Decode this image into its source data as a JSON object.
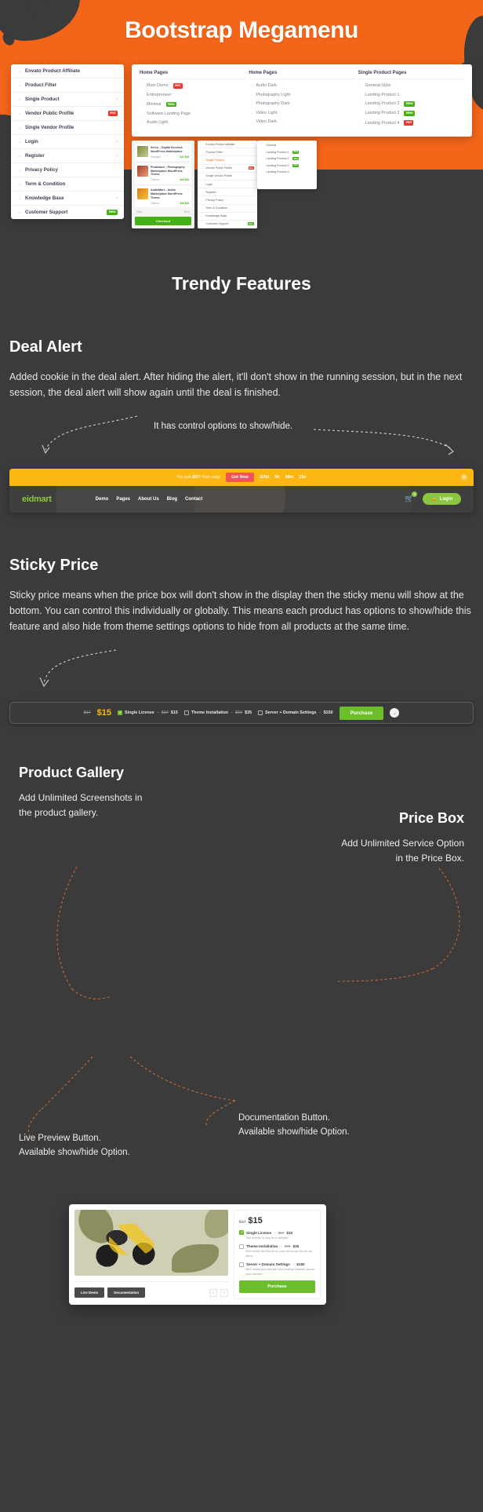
{
  "hero": {
    "title": "Bootstrap Megamenu",
    "bg": "#f3661a"
  },
  "megamenu": {
    "left_items": [
      {
        "label": "Envato Product Affiliate",
        "badge": "",
        "chevron": false
      },
      {
        "label": "Product Filter",
        "badge": "",
        "chevron": false
      },
      {
        "label": "Single Product",
        "badge": "",
        "chevron": true
      },
      {
        "label": "Vendor Public Profile",
        "badge": "Hot",
        "badge_type": "hot",
        "chevron": false
      },
      {
        "label": "Single Vendor Profile",
        "badge": "",
        "chevron": false
      },
      {
        "label": "Login",
        "badge": "",
        "chevron": true
      },
      {
        "label": "Register",
        "badge": "",
        "chevron": true
      },
      {
        "label": "Privacy Policy",
        "badge": "",
        "chevron": false
      },
      {
        "label": "Term & Condition",
        "badge": "",
        "chevron": false
      },
      {
        "label": "Knowledge Base",
        "badge": "",
        "chevron": true
      },
      {
        "label": "Customer Support",
        "badge": "New",
        "badge_type": "new",
        "chevron": false
      }
    ],
    "columns": [
      {
        "heading": "Home Pages",
        "items": [
          {
            "label": "Main Demo",
            "badge": "Hot",
            "badge_type": "hot"
          },
          {
            "label": "Entrepreneur",
            "badge": ""
          },
          {
            "label": "Minimal",
            "badge": "New",
            "badge_type": "new"
          },
          {
            "label": "Software Landing Page",
            "badge": ""
          },
          {
            "label": "Audio Light",
            "badge": ""
          }
        ]
      },
      {
        "heading": "Home Pages",
        "items": [
          {
            "label": "Audio Dark",
            "badge": ""
          },
          {
            "label": "Photography Light",
            "badge": ""
          },
          {
            "label": "Photography Dark",
            "badge": ""
          },
          {
            "label": "Video Light",
            "badge": ""
          },
          {
            "label": "Video Dark",
            "badge": ""
          }
        ]
      },
      {
        "heading": "Single Product Pages",
        "items": [
          {
            "label": "General Style",
            "badge": ""
          },
          {
            "label": "Landing Product 1",
            "badge": ""
          },
          {
            "label": "Landing Product 2",
            "badge": "New",
            "badge_type": "new"
          },
          {
            "label": "Landing Product 3",
            "badge": "New",
            "badge_type": "new"
          },
          {
            "label": "Landing Product 4",
            "badge": "Hot",
            "badge_type": "hot"
          }
        ]
      }
    ],
    "product_card": {
      "products": [
        {
          "name": "Servo – Digital Services WordPress Marketplace",
          "category": "Template",
          "price": "$47 $35"
        },
        {
          "name": "Photoland – Photography Marketplace WordPress Theme",
          "category": "Themes",
          "price": "$49 $39"
        },
        {
          "name": "AudioMart – Audio Marketplace WordPress Theme",
          "category": "Themes",
          "price": "$45 $29"
        }
      ],
      "total_label": "Total",
      "total_value": "$103",
      "button": "Checkout"
    },
    "mini_menu": [
      {
        "label": "Envato Product Affiliate",
        "badge": ""
      },
      {
        "label": "Product Filter",
        "badge": ""
      },
      {
        "label": "Single Product",
        "badge": "",
        "active": true
      },
      {
        "label": "Vendor Public Profile",
        "badge": "Hot",
        "badge_type": "hot"
      },
      {
        "label": "Single Vendor Profile",
        "badge": ""
      },
      {
        "label": "Login",
        "badge": "",
        "chevron": true
      },
      {
        "label": "Register",
        "badge": "",
        "chevron": true
      },
      {
        "label": "Privacy Policy",
        "badge": ""
      },
      {
        "label": "Term & Condition",
        "badge": ""
      },
      {
        "label": "Knowledge Base",
        "badge": ""
      },
      {
        "label": "Customer Support",
        "badge": "New",
        "badge_type": "new"
      }
    ],
    "mini_menu2": [
      {
        "label": "General",
        "badge": ""
      },
      {
        "label": "Landing Product 1",
        "badge": "New",
        "badge_type": "new"
      },
      {
        "label": "Landing Product 2",
        "badge": "New",
        "badge_type": "new"
      },
      {
        "label": "Landing Product 3",
        "badge": "New",
        "badge_type": "new"
      },
      {
        "label": "Landing Product 4",
        "badge": ""
      }
    ]
  },
  "features_title": "Trendy Features",
  "deal_alert": {
    "heading": "Deal Alert",
    "body": "Added cookie in the deal alert. After hiding the alert, it'll don't show in the running session, but in the next session, the deal alert will show again until the deal is finished.",
    "annotation": "It has control options to show/hide.",
    "bar": {
      "text_prefix": "For just ",
      "price": "$57!",
      "text_suffix": " Your copy",
      "button": "Get Now",
      "countdown": [
        "326d",
        "5h",
        "58m",
        "15s"
      ],
      "close_icon": "close-icon",
      "bg": "#fcb713"
    },
    "nav": {
      "logo_accent": "e",
      "logo_rest": "idmart",
      "links": [
        "Demo",
        "Pages",
        "About Us",
        "Blog",
        "Contact"
      ],
      "cart_count": "0",
      "login_label": "Login"
    }
  },
  "sticky_price": {
    "heading": "Sticky Price",
    "body": "Sticky price means when the price box will don't show in the display then the sticky menu will show at the bottom. You can control this individually or globally. This means each product has options to show/hide this feature and also hide from theme settings options to hide from all products at the same time.",
    "bar": {
      "old_price": "$17",
      "new_price": "$15",
      "options": [
        {
          "label": "Single License",
          "old": "$17",
          "price": "$15",
          "checked": true
        },
        {
          "label": "Theme Installation",
          "old": "$50",
          "price": "$35",
          "checked": false
        },
        {
          "label": "Server + Domain Settings",
          "old": "",
          "price": "$150",
          "checked": false
        }
      ],
      "button": "Purchase",
      "toggle_icon": "chevron-down-icon"
    }
  },
  "gallery": {
    "heading": "Product Gallery",
    "body_line1": "Add Unlimited Screenshots in",
    "body_line2": "the product gallery.",
    "buttons": [
      "Live Demo",
      "Documentation"
    ],
    "prev_icon": "chevron-left-icon",
    "next_icon": "chevron-right-icon"
  },
  "price_box": {
    "heading": "Price Box",
    "body_line1": "Add Unlimited Service Option",
    "body_line2": "in the Price Box.",
    "old_price": "$17",
    "new_price": "$15",
    "options": [
      {
        "label": "Single License",
        "old": "$17",
        "price": "$15",
        "checked": true,
        "desc": "This license is only for a website."
      },
      {
        "label": "Theme Installation",
        "old": "$50",
        "price": "$35",
        "checked": false,
        "desc": "We'll install the theme on your server as like as our demo."
      },
      {
        "label": "Server + Domain Settings",
        "old": "",
        "price": "$150",
        "checked": false,
        "desc": "We'll ready your domain and hosting instantly launch your website."
      }
    ],
    "button": "Purchase"
  },
  "bottom_notes": {
    "left_line1": "Live Preview Button.",
    "left_line2": "Available show/hide Option.",
    "right_line1": "Documentation Button.",
    "right_line2": "Available show/hide Option."
  }
}
